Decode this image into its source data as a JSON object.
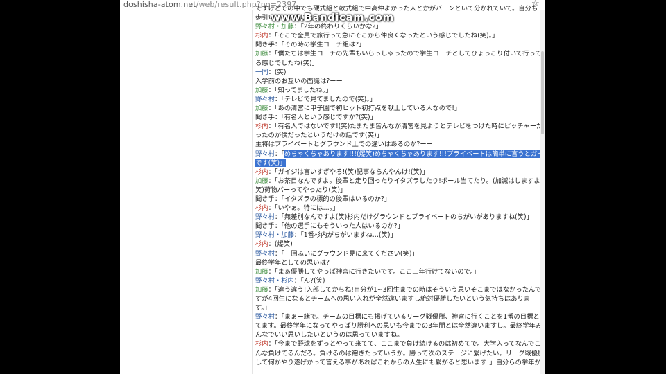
{
  "browser": {
    "url_host": "doshisha-atom.net",
    "url_path": "/web/result.php?no=2397",
    "bookmark_icon": "star-icon"
  },
  "watermark": "www.Bandicam.com",
  "lines": [
    {
      "t": "ですけどその中でも硬式組と軟式組で中高仲よかった人とかがバーンといて分かれていて。自分も一"
    },
    {
      "t": "歩引いてって感じでした。2年から?」"
    },
    {
      "s": "野々村・加藤",
      "c": "green",
      "t": "：「2年の終わりくらいかな?」"
    },
    {
      "s": "杉内",
      "c": "red",
      "t": "：「そこで全員で旅行って急にそこから仲良くなったという感じでしたね(笑)。」"
    },
    {
      "t": "聞き手：「その時の学生コーチ組は?」"
    },
    {
      "s": "加藤",
      "c": "green",
      "t": "：「僕たちは学生コーチの先輩もいらっしゃったので学生コーチとしてひょっこり付いて行ってる"
    },
    {
      "t": "る感じでしたね(笑)」"
    },
    {
      "s": "一同",
      "c": "blue",
      "t": "：(笑)"
    },
    {
      "t": "入学前のお互いの面識は?ーー"
    },
    {
      "s": "加藤",
      "c": "green",
      "t": "：「知ってましたね。」"
    },
    {
      "s": "野々村",
      "c": "blue",
      "t": "：「テレビで見てましたので(笑)。」"
    },
    {
      "s": "加藤",
      "c": "green",
      "t": "：「あの清宮に甲子園で初ヒット初打点を献上している人なので!」"
    },
    {
      "t": "聞き手：「有名人という感じですか?(笑)」"
    },
    {
      "s": "杉内",
      "c": "red",
      "t": "：「有名人ではないです!(笑)たまたま皆んなが清宮を見ようとテレビをつけた時にピッチャーだ"
    },
    {
      "t": "ったのが僕だったというだけの話です(笑)」"
    },
    {
      "t": "主将はプライベートとグラウンド上での違いはあるのか?ーー"
    },
    {
      "s": "野々村",
      "c": "blue",
      "t": "：「",
      "h": "めちゃくちゃあります!!!(爆笑)めちゃくちゃあります!!!プライベートは簡単に言うとガイジ"
    },
    {
      "h": "です(笑)」"
    },
    {
      "s": "杉内",
      "c": "red",
      "t": "：「ガイジは言いすぎやろ!(笑)記事ならんやんけ!(笑)」"
    },
    {
      "s": "加藤",
      "c": "green",
      "t": "：「お茶目なんですよ。後輩と走り回ったりイタズラしたり!ボール当てたり。(加減はしますよ("
    },
    {
      "t": "笑)荷物バーってやったり(笑)」"
    },
    {
      "t": "聞き手：「イタズラの標的の後輩はいるのか?」"
    },
    {
      "s": "杉内",
      "c": "red",
      "t": "：「いやぁ。特には…。」"
    },
    {
      "s": "野々村",
      "c": "blue",
      "t": "：「無差別なんですよ(笑)杉内だけグラウンドとプライベートのちがいがありますね(笑)」"
    },
    {
      "t": "聞き手：「他の選手にもそういった人はいるのか?」"
    },
    {
      "s": "野々村・加藤",
      "c": "blue",
      "t": "：「1番杉内がちがいますね…(笑)」"
    },
    {
      "s": "杉内",
      "c": "red",
      "t": "：(爆笑)"
    },
    {
      "s": "野々村",
      "c": "blue",
      "t": "：「一回ふいにグラウンド見に来てください(笑)」"
    },
    {
      "t": "最終学年としての思いは?ーー"
    },
    {
      "s": "加藤",
      "c": "green",
      "t": "：「まぁ優勝してやっぱ神宮に行きたいです。ここ三年行けてないので。」"
    },
    {
      "s": "野々村・杉内",
      "c": "blue",
      "t": "：「ん?(笑)」"
    },
    {
      "s": "加藤",
      "c": "green",
      "t": "：「違う違う!入部してからね!自分が1~3回生までの時はそういう思いそこまではなかったんで"
    },
    {
      "t": "すが4回生になるとチームへの思い入れが全然違いますし絶対優勝したいという気持ちはありま"
    },
    {
      "t": "す。」"
    },
    {
      "s": "野々村",
      "c": "blue",
      "t": "：「まぁー緒で。チームの目標にも掲げているリーグ戦優勝、神宮に行くことを1番の目標とし"
    },
    {
      "t": "てます。最終学年になってやっぱり勝利への思いも今までの3年間とは全然違いますし。最終学年み"
    },
    {
      "t": "んなでいい思いしたいというのは思っていますね。」"
    },
    {
      "s": "杉内",
      "c": "red",
      "t": "：「今まで野球をずっとやって来てて、ここまで負け続けるのは初めてで。大学入ってなんでこ"
    },
    {
      "t": "んな負けてるんだろ。負けるのは飽きたっていうか。勝って次のステージに繋げたい。リーグ戦優勝"
    },
    {
      "t": "して何かやり遂げかって言える事があればこれからの人生にも繋がると思います!」自分らの学年が"
    }
  ]
}
